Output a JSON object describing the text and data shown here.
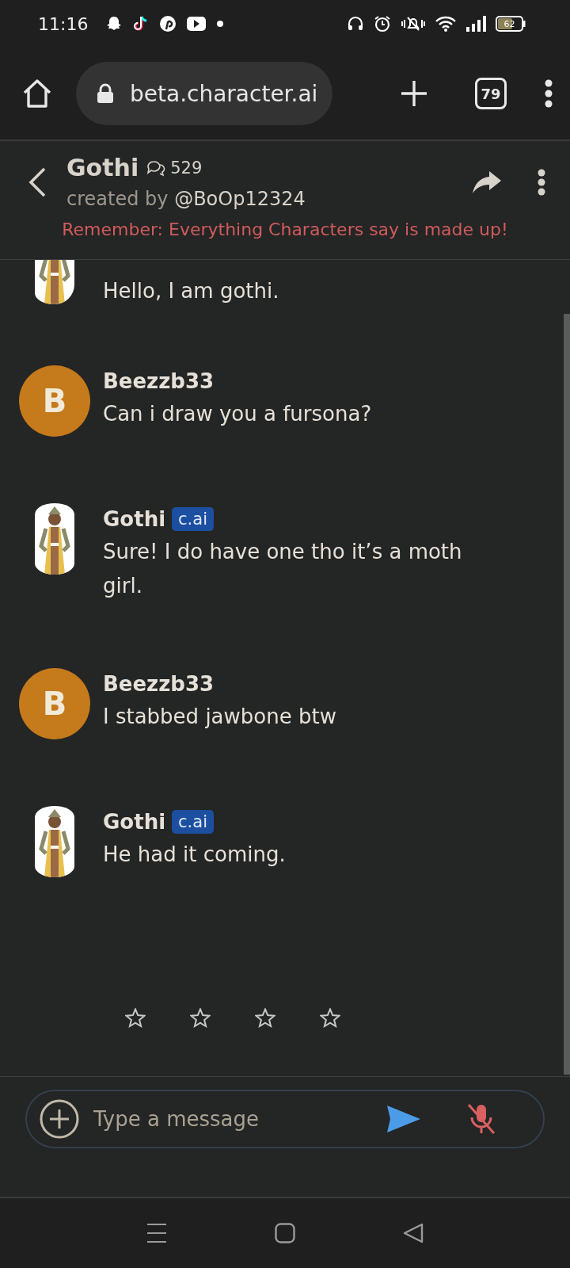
{
  "status_bar": {
    "time": "11:16",
    "battery": "62"
  },
  "browser": {
    "url": "beta.character.ai",
    "tab_count": "79"
  },
  "header": {
    "name": "Gothi",
    "chat_count": "529",
    "creator_label": "created by",
    "creator": "@BoOp12324",
    "disclaimer": "Remember: Everything Characters say is made up!"
  },
  "messages": [
    {
      "kind": "character",
      "cut": true,
      "text": "Hello, I am gothi."
    },
    {
      "kind": "user",
      "author": "Beezzb33",
      "initial": "B",
      "color": "#c57a1c",
      "text": "Can i draw you a fursona?"
    },
    {
      "kind": "character",
      "cut": false,
      "author": "Gothi",
      "badge": "c.ai",
      "text": "Sure! I do have one tho it’s a moth girl."
    },
    {
      "kind": "user",
      "author": "Beezzb33",
      "initial": "B",
      "color": "#c57a1c",
      "text": "I stabbed jawbone btw"
    },
    {
      "kind": "character",
      "cut": false,
      "author": "Gothi",
      "badge": "c.ai",
      "text": "He had it coming."
    }
  ],
  "rating": {
    "stars": 0
  },
  "composer": {
    "placeholder": "Type a message"
  }
}
